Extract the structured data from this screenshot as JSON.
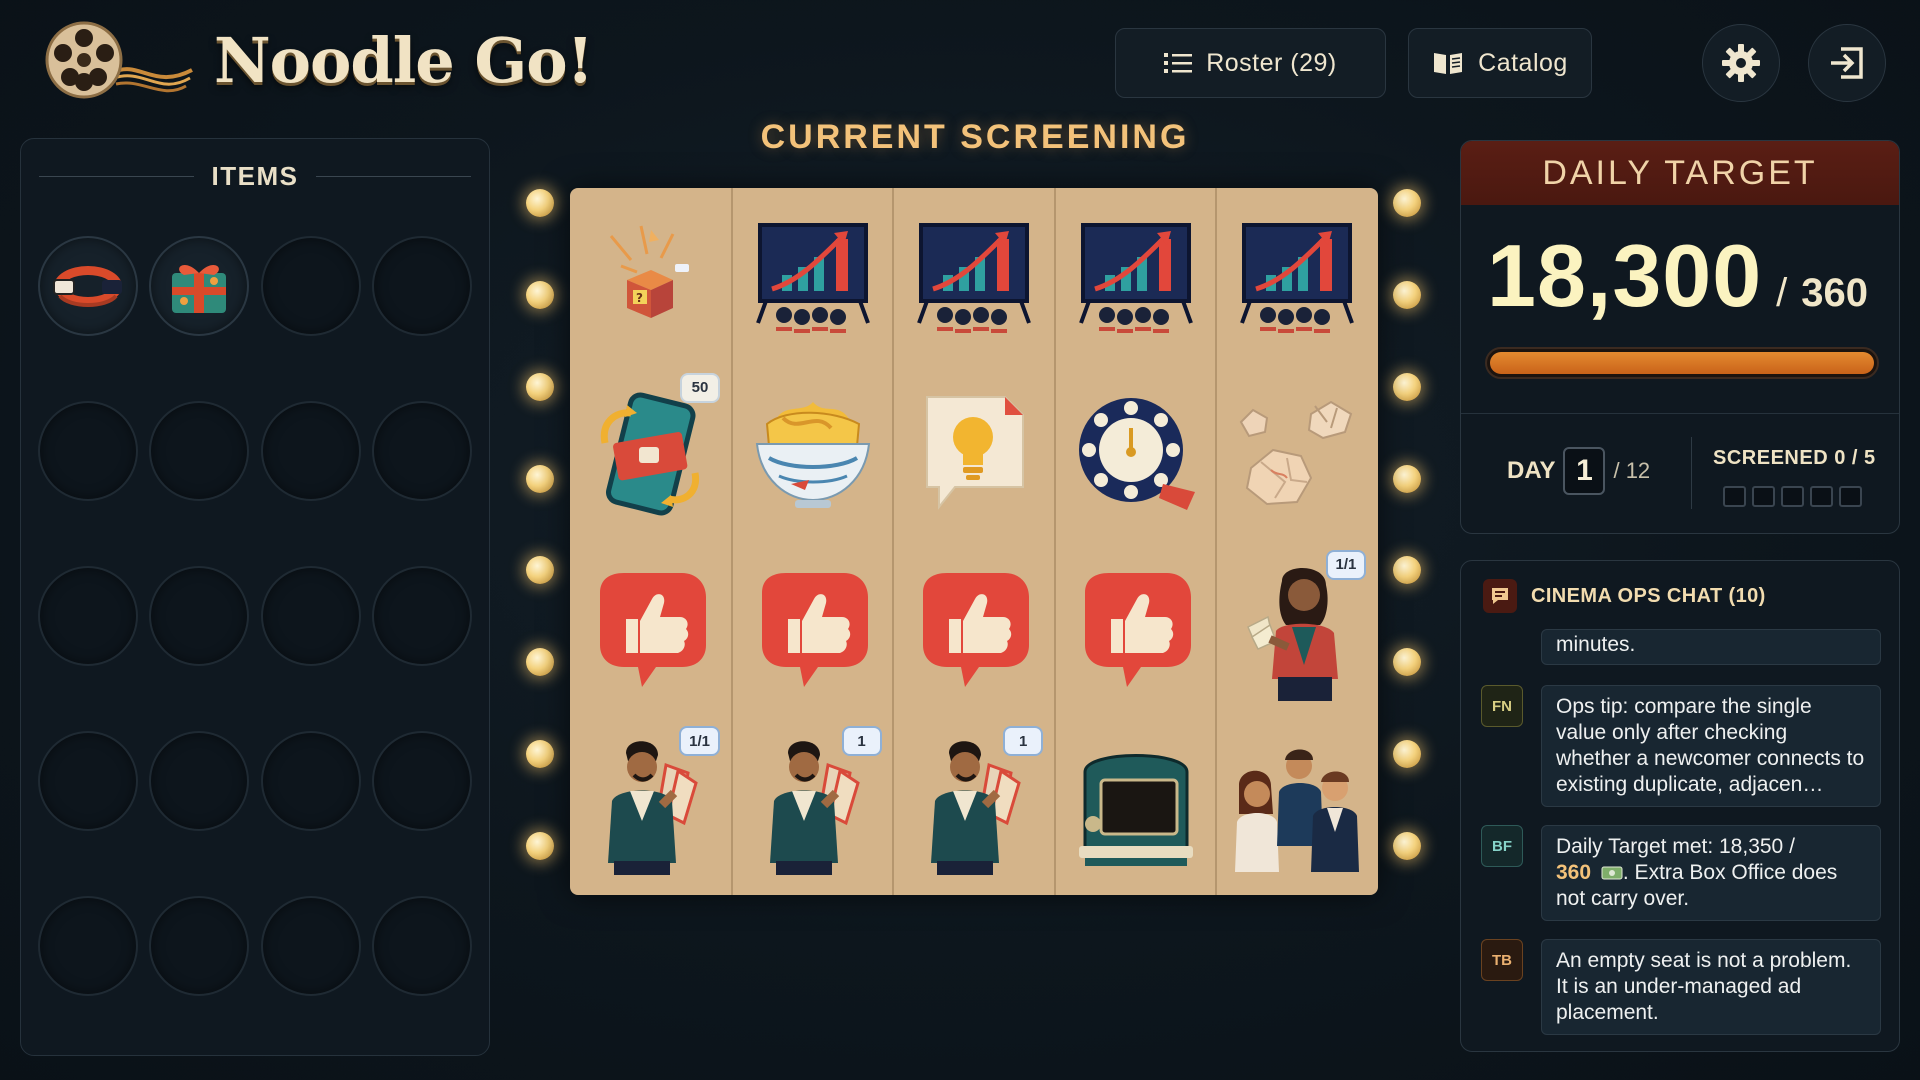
{
  "app": {
    "title": "Noodle Go!"
  },
  "header": {
    "roster_label": "Roster (29)",
    "catalog_label": "Catalog"
  },
  "items_panel": {
    "title": "ITEMS",
    "slots": [
      "wristband-item",
      "gift-box-item",
      "",
      "",
      "",
      "",
      "",
      "",
      "",
      "",
      "",
      "",
      "",
      "",
      "",
      "",
      "",
      "",
      "",
      ""
    ]
  },
  "screening": {
    "title": "CURRENT SCREENING",
    "grid": [
      [
        {
          "icon": "mystery-box-icon"
        },
        {
          "icon": "growth-chart-icon"
        },
        {
          "icon": "growth-chart-icon"
        },
        {
          "icon": "growth-chart-icon"
        },
        {
          "icon": "growth-chart-icon"
        }
      ],
      [
        {
          "icon": "ticket-phone-icon",
          "badge": "50"
        },
        {
          "icon": "noodle-bowl-icon"
        },
        {
          "icon": "idea-bulb-icon"
        },
        {
          "icon": "clock-icon"
        },
        {
          "icon": "crumpled-paper-icon"
        }
      ],
      [
        {
          "icon": "thumbs-up-icon"
        },
        {
          "icon": "thumbs-up-icon"
        },
        {
          "icon": "thumbs-up-icon"
        },
        {
          "icon": "thumbs-up-icon"
        },
        {
          "icon": "woman-cash-icon",
          "badge": "1/1"
        }
      ],
      [
        {
          "icon": "ticket-guy-icon",
          "badge": "1/1"
        },
        {
          "icon": "ticket-guy-icon",
          "badge": "1"
        },
        {
          "icon": "ticket-guy-icon",
          "badge": "1"
        },
        {
          "icon": "retro-tv-icon"
        },
        {
          "icon": "friends-group-icon"
        }
      ]
    ]
  },
  "daily_target": {
    "title": "DAILY TARGET",
    "value": "18,300",
    "separator": "/",
    "goal": "360",
    "progress": 1.0,
    "day_label": "DAY",
    "day_value": "1",
    "day_total": "/ 12",
    "screened_label": "SCREENED 0 / 5",
    "screened_done": 0,
    "screened_total": 5
  },
  "chat": {
    "title": "CINEMA OPS CHAT (10)",
    "messages": [
      {
        "initials": "",
        "text": "minutes."
      },
      {
        "initials": "FN",
        "text": "Ops tip: compare the single value only after checking whether a newcomer connects to existing duplicate, adjacen…"
      },
      {
        "initials": "BF",
        "text_a": "Daily Target met: 18,350 /",
        "text_b": "360",
        "text_c": ". Extra Box Office does not carry over."
      },
      {
        "initials": "TB",
        "text": "An empty seat is not a problem. It is an under-managed ad placement."
      }
    ]
  },
  "colors": {
    "accent": "#f3c27a",
    "target_header": "#5a1e14",
    "progress": "#e48a30",
    "reel_bg": "#d4b48a",
    "thumbs_red": "#e2473b"
  }
}
